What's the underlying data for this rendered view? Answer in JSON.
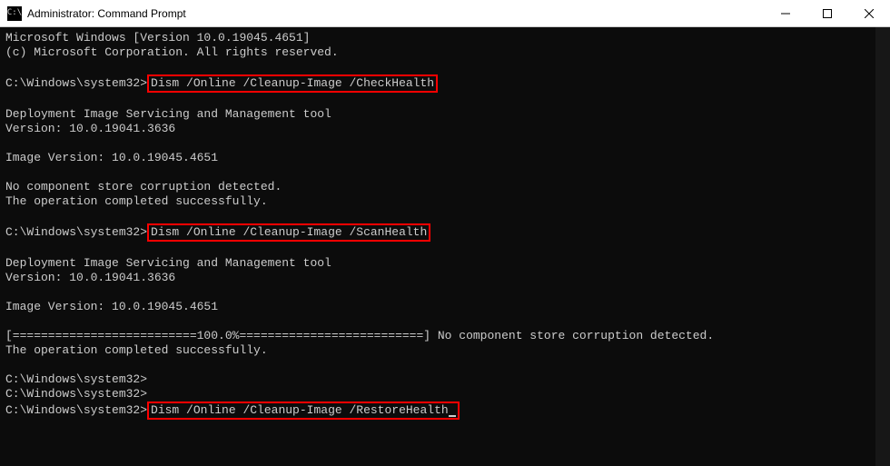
{
  "window": {
    "title": "Administrator: Command Prompt",
    "icon_label": "cmd-icon"
  },
  "terminal": {
    "line1": "Microsoft Windows [Version 10.0.19045.4651]",
    "line2": "(c) Microsoft Corporation. All rights reserved.",
    "prompt": "C:\\Windows\\system32>",
    "cmd1": "Dism /Online /Cleanup-Image /CheckHealth",
    "tool_header": "Deployment Image Servicing and Management tool",
    "tool_version": "Version: 10.0.19041.3636",
    "image_version": "Image Version: 10.0.19045.4651",
    "result1a": "No component store corruption detected.",
    "result1b": "The operation completed successfully.",
    "cmd2": "Dism /Online /Cleanup-Image /ScanHealth",
    "progress": "[==========================100.0%==========================] No component store corruption detected.",
    "result2": "The operation completed successfully.",
    "cmd3": "Dism /Online /Cleanup-Image /RestoreHealth"
  }
}
